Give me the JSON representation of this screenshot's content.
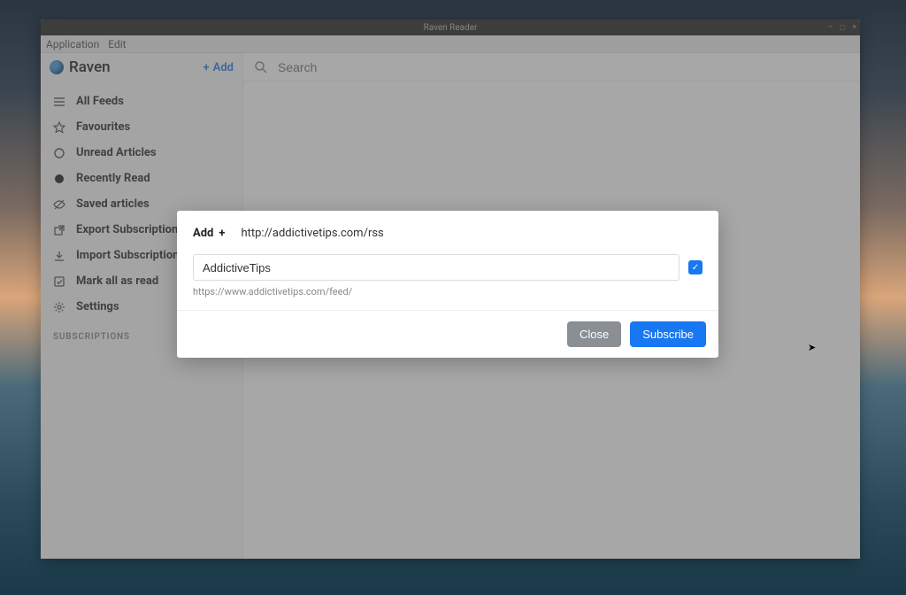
{
  "window": {
    "title": "Raven Reader",
    "controls": {
      "min": "–",
      "max": "□",
      "close": "×"
    }
  },
  "menubar": {
    "items": [
      "Application",
      "Edit"
    ]
  },
  "brand": {
    "name": "Raven"
  },
  "add_button": {
    "plus": "+",
    "label": "Add"
  },
  "search": {
    "placeholder": "Search"
  },
  "nav": {
    "items": [
      {
        "icon": "list-icon",
        "label": "All Feeds"
      },
      {
        "icon": "star-icon",
        "label": "Favourites"
      },
      {
        "icon": "circle-icon",
        "label": "Unread Articles"
      },
      {
        "icon": "dot-icon",
        "label": "Recently Read"
      },
      {
        "icon": "eye-off-icon",
        "label": "Saved articles"
      },
      {
        "icon": "external-icon",
        "label": "Export Subscriptions"
      },
      {
        "icon": "download-icon",
        "label": "Import Subscriptions"
      },
      {
        "icon": "check-square-icon",
        "label": "Mark all as read"
      },
      {
        "icon": "gear-icon",
        "label": "Settings"
      }
    ],
    "subs_header": "SUBSCRIPTIONS"
  },
  "dialog": {
    "add_label": "Add",
    "plus": "+",
    "entered_url": "http://addictivetips.com/rss",
    "feed_name": "AddictiveTips",
    "resolved_feed_url": "https://www.addictivetips.com/feed/",
    "checkmark": "✓",
    "close_label": "Close",
    "subscribe_label": "Subscribe"
  }
}
